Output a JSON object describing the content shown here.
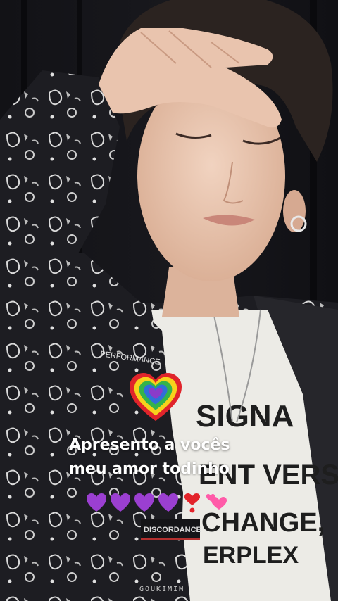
{
  "caption": {
    "line1": "Apresento a vocês",
    "line2": "meu amor todinho"
  },
  "emojis": [
    "purple-heart",
    "purple-heart",
    "purple-heart",
    "purple-heart",
    "red-exclamation-heart",
    "two-hearts"
  ],
  "shirt_text": {
    "line1": "SIGNA",
    "line2": "ENT VERS",
    "line3": "CHANGE,",
    "line4": "ERPLEX"
  },
  "jacket_tag": "DISCORDANCE",
  "jacket_patch": "PERFORMANCE",
  "watermark": "GOUKIMIM",
  "colors": {
    "background": "#0d0d10",
    "jacket": "#1f1f24",
    "shirt": "#ecebe6",
    "skin": "#e8c6b0",
    "hair": "#2b2320",
    "caption": "#ffffff",
    "purple_heart": "#9b3fd1"
  }
}
